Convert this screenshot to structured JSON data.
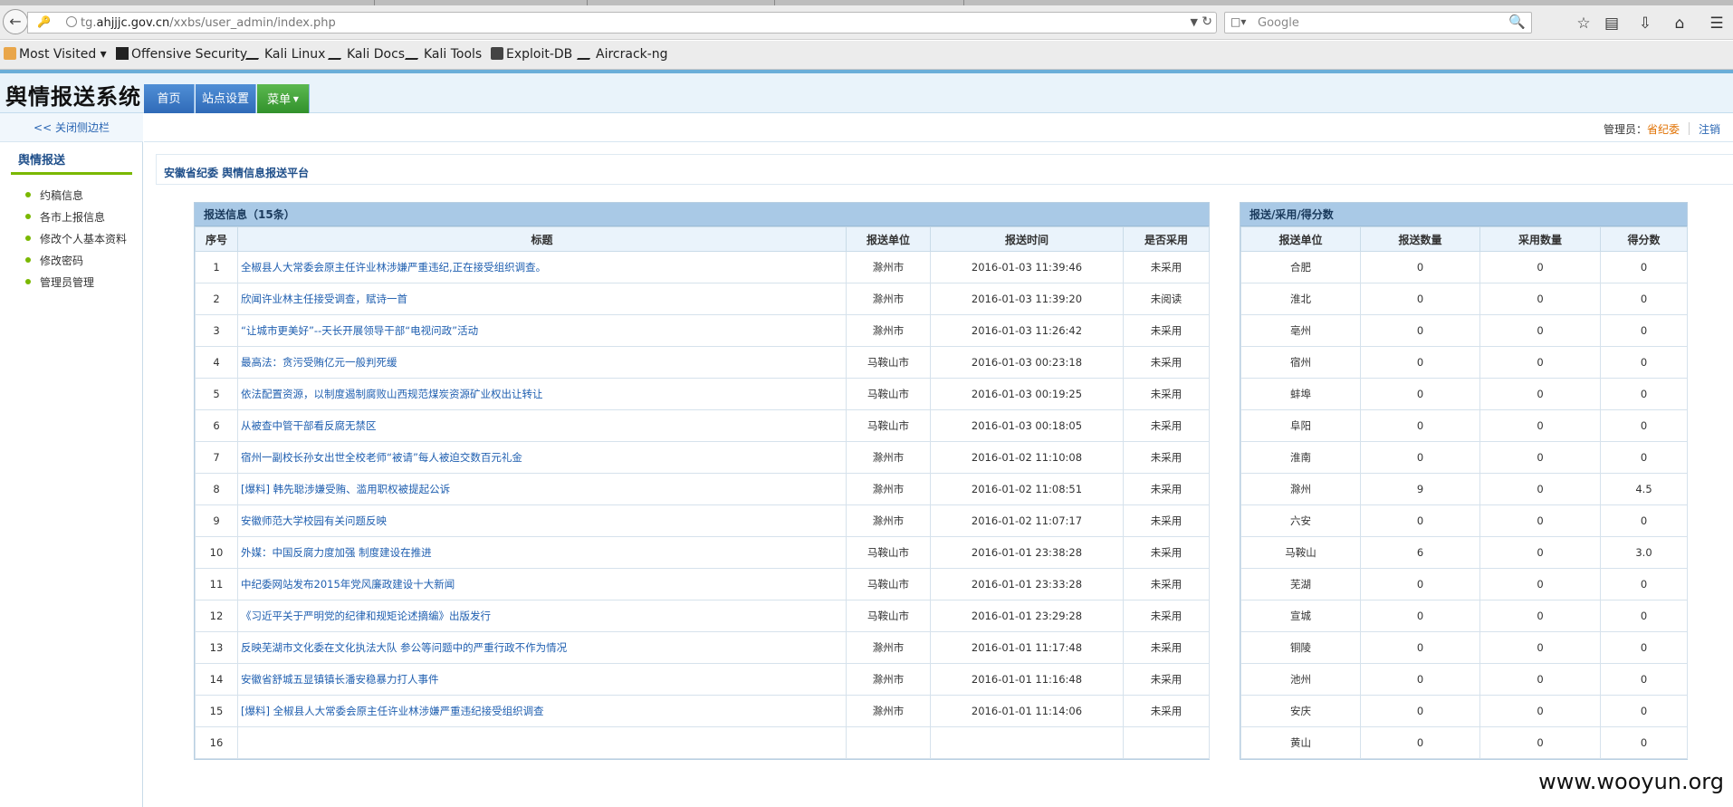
{
  "browser": {
    "url_prefix": "tg.",
    "url_domain": "ahjjjc.gov.cn",
    "url_path": "/xxbs/user_admin/index.php",
    "search_placeholder": "Google",
    "bookmarks": [
      "Most Visited",
      "Offensive Security",
      "Kali Linux",
      "Kali Docs",
      "Kali Tools",
      "Exploit-DB",
      "Aircrack-ng"
    ]
  },
  "app": {
    "title": "舆情报送系统",
    "nav": [
      "首页",
      "站点设置",
      "菜单"
    ]
  },
  "sidebar": {
    "close_label": "<< 关闭侧边栏",
    "section_title": "舆情报送",
    "items": [
      "约稿信息",
      "各市上报信息",
      "修改个人基本资料",
      "修改密码",
      "管理员管理"
    ]
  },
  "userbar": {
    "label": "管理员：",
    "username": "省纪委",
    "logout": "注销"
  },
  "platform_title": "安徽省纪委 舆情信息报送平台",
  "reports": {
    "caption": "报送信息（15条）",
    "headers": [
      "序号",
      "标题",
      "报送单位",
      "报送时间",
      "是否采用"
    ],
    "rows": [
      {
        "no": "1",
        "title": "全椒县人大常委会原主任许业林涉嫌严重违纪,正在接受组织调查。",
        "unit": "滁州市",
        "time": "2016-01-03 11:39:46",
        "status": "未采用"
      },
      {
        "no": "2",
        "title": "欣闻许业林主任接受调查，赋诗一首",
        "unit": "滁州市",
        "time": "2016-01-03 11:39:20",
        "status": "未阅读"
      },
      {
        "no": "3",
        "title": "“让城市更美好”--天长开展领导干部“电视问政”活动",
        "unit": "滁州市",
        "time": "2016-01-03 11:26:42",
        "status": "未采用"
      },
      {
        "no": "4",
        "title": "最高法：贪污受贿亿元一般判死缓",
        "unit": "马鞍山市",
        "time": "2016-01-03 00:23:18",
        "status": "未采用"
      },
      {
        "no": "5",
        "title": "依法配置资源，以制度遏制腐败山西规范煤炭资源矿业权出让转让",
        "unit": "马鞍山市",
        "time": "2016-01-03 00:19:25",
        "status": "未采用"
      },
      {
        "no": "6",
        "title": "从被查中管干部看反腐无禁区",
        "unit": "马鞍山市",
        "time": "2016-01-03 00:18:05",
        "status": "未采用"
      },
      {
        "no": "7",
        "title": "宿州一副校长孙女出世全校老师“被请”每人被迫交数百元礼金",
        "unit": "滁州市",
        "time": "2016-01-02 11:10:08",
        "status": "未采用"
      },
      {
        "no": "8",
        "title": "[爆料] 韩先聪涉嫌受贿、滥用职权被提起公诉",
        "unit": "滁州市",
        "time": "2016-01-02 11:08:51",
        "status": "未采用"
      },
      {
        "no": "9",
        "title": "安徽师范大学校园有关问题反映",
        "unit": "滁州市",
        "time": "2016-01-02 11:07:17",
        "status": "未采用"
      },
      {
        "no": "10",
        "title": "外媒：中国反腐力度加强 制度建设在推进",
        "unit": "马鞍山市",
        "time": "2016-01-01 23:38:28",
        "status": "未采用"
      },
      {
        "no": "11",
        "title": "中纪委网站发布2015年党风廉政建设十大新闻",
        "unit": "马鞍山市",
        "time": "2016-01-01 23:33:28",
        "status": "未采用"
      },
      {
        "no": "12",
        "title": "《习近平关于严明党的纪律和规矩论述摘编》出版发行",
        "unit": "马鞍山市",
        "time": "2016-01-01 23:29:28",
        "status": "未采用"
      },
      {
        "no": "13",
        "title": "反映芜湖市文化委在文化执法大队 参公等问题中的严重行政不作为情况",
        "unit": "滁州市",
        "time": "2016-01-01 11:17:48",
        "status": "未采用"
      },
      {
        "no": "14",
        "title": "安徽省舒城五显镇镇长潘安稳暴力打人事件",
        "unit": "滁州市",
        "time": "2016-01-01 11:16:48",
        "status": "未采用"
      },
      {
        "no": "15",
        "title": "[爆料] 全椒县人大常委会原主任许业林涉嫌严重违纪接受组织调查",
        "unit": "滁州市",
        "time": "2016-01-01 11:14:06",
        "status": "未采用"
      },
      {
        "no": "16",
        "title": "",
        "unit": "",
        "time": "",
        "status": ""
      }
    ]
  },
  "scores": {
    "caption": "报送/采用/得分数",
    "headers": [
      "报送单位",
      "报送数量",
      "采用数量",
      "得分数"
    ],
    "rows": [
      {
        "unit": "合肥",
        "sent": "0",
        "adopted": "0",
        "score": "0"
      },
      {
        "unit": "淮北",
        "sent": "0",
        "adopted": "0",
        "score": "0"
      },
      {
        "unit": "亳州",
        "sent": "0",
        "adopted": "0",
        "score": "0"
      },
      {
        "unit": "宿州",
        "sent": "0",
        "adopted": "0",
        "score": "0"
      },
      {
        "unit": "蚌埠",
        "sent": "0",
        "adopted": "0",
        "score": "0"
      },
      {
        "unit": "阜阳",
        "sent": "0",
        "adopted": "0",
        "score": "0"
      },
      {
        "unit": "淮南",
        "sent": "0",
        "adopted": "0",
        "score": "0"
      },
      {
        "unit": "滁州",
        "sent": "9",
        "adopted": "0",
        "score": "4.5"
      },
      {
        "unit": "六安",
        "sent": "0",
        "adopted": "0",
        "score": "0"
      },
      {
        "unit": "马鞍山",
        "sent": "6",
        "adopted": "0",
        "score": "3.0"
      },
      {
        "unit": "芜湖",
        "sent": "0",
        "adopted": "0",
        "score": "0"
      },
      {
        "unit": "宣城",
        "sent": "0",
        "adopted": "0",
        "score": "0"
      },
      {
        "unit": "铜陵",
        "sent": "0",
        "adopted": "0",
        "score": "0"
      },
      {
        "unit": "池州",
        "sent": "0",
        "adopted": "0",
        "score": "0"
      },
      {
        "unit": "安庆",
        "sent": "0",
        "adopted": "0",
        "score": "0"
      },
      {
        "unit": "黄山",
        "sent": "0",
        "adopted": "0",
        "score": "0"
      }
    ]
  },
  "watermark": "www.wooyun.org"
}
